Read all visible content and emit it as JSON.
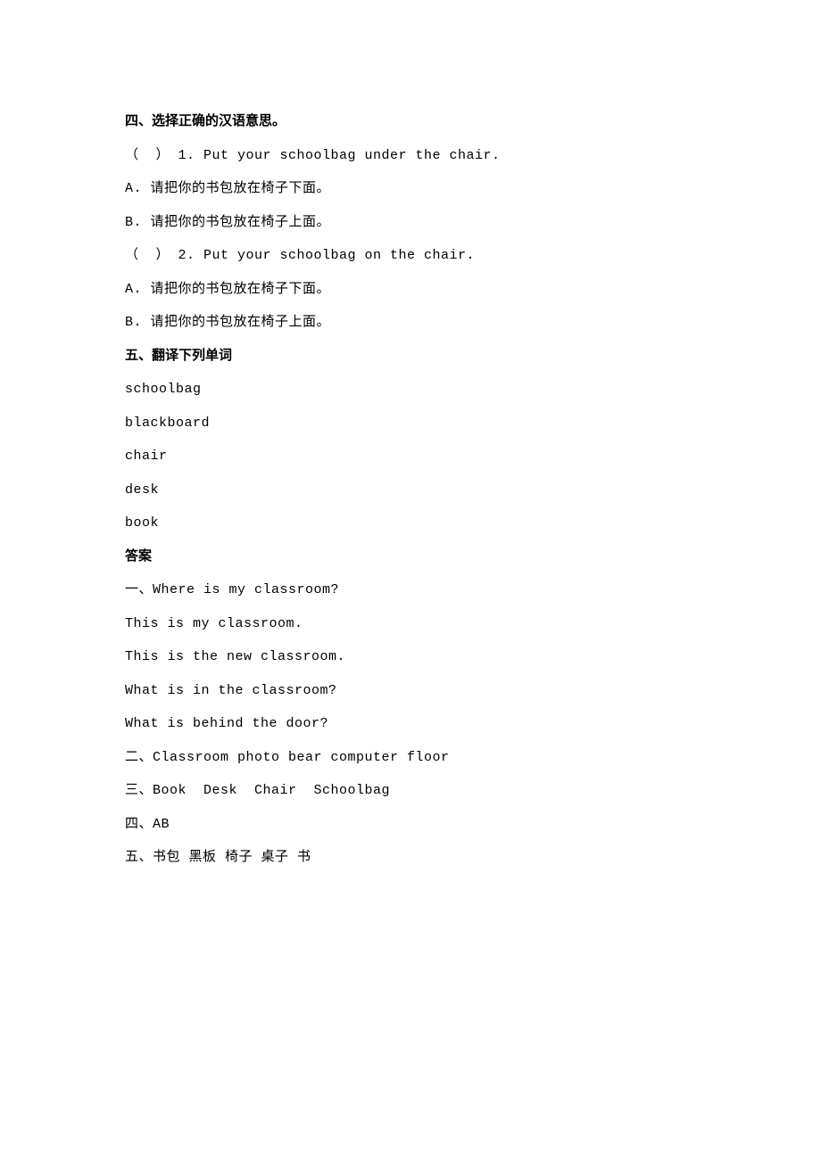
{
  "section4": {
    "heading": "四、选择正确的汉语意思。",
    "q1": {
      "prompt": "（  ） 1. Put your schoolbag under the chair.",
      "optA": "A. 请把你的书包放在椅子下面。",
      "optB": "B. 请把你的书包放在椅子上面。"
    },
    "q2": {
      "prompt": "（  ） 2. Put your schoolbag on the chair.",
      "optA": "A. 请把你的书包放在椅子下面。",
      "optB": "B. 请把你的书包放在椅子上面。"
    }
  },
  "section5": {
    "heading": "五、翻译下列单词",
    "words": {
      "w1": "schoolbag",
      "w2": "blackboard",
      "w3": "chair",
      "w4": "desk",
      "w5": "book"
    }
  },
  "answers": {
    "heading": "答案",
    "a1": "一、Where is my classroom?",
    "a1_2": "This is my classroom.",
    "a1_3": "This is the new classroom.",
    "a1_4": "What is in the classroom?",
    "a1_5": "What is behind the door?",
    "a2": "二、Classroom photo bear computer floor",
    "a3": "三、Book  Desk  Chair  Schoolbag",
    "a4": "四、AB",
    "a5": "五、书包 黑板 椅子 桌子 书"
  }
}
